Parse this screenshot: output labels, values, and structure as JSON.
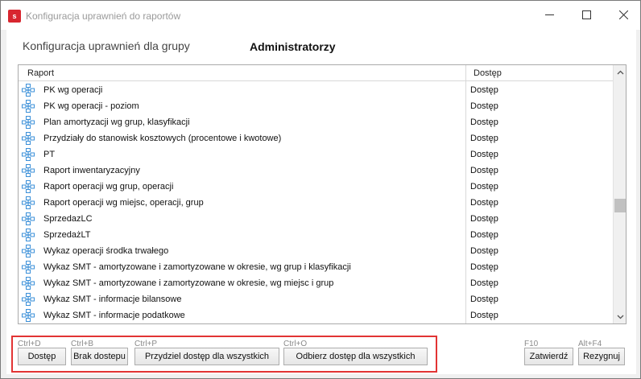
{
  "window": {
    "app_icon_letter": "s",
    "title": "Konfiguracja uprawnień do raportów"
  },
  "header": {
    "group_label": "Konfiguracja uprawnień dla grupy",
    "group_name": "Administratorzy"
  },
  "grid": {
    "columns": {
      "report": "Raport",
      "access": "Dostęp"
    },
    "rows": [
      {
        "name": "PK wg operacji",
        "access": "Dostęp"
      },
      {
        "name": "PK wg operacji - poziom",
        "access": "Dostęp"
      },
      {
        "name": "Plan amortyzacji wg grup, klasyfikacji",
        "access": "Dostęp"
      },
      {
        "name": "Przydziały do stanowisk kosztowych (procentowe i kwotowe)",
        "access": "Dostęp"
      },
      {
        "name": "PT",
        "access": "Dostęp"
      },
      {
        "name": "Raport inwentaryzacyjny",
        "access": "Dostęp"
      },
      {
        "name": "Raport operacji wg grup, operacji",
        "access": "Dostęp"
      },
      {
        "name": "Raport operacji wg miejsc, operacji, grup",
        "access": "Dostęp"
      },
      {
        "name": "SprzedazLC",
        "access": "Dostęp"
      },
      {
        "name": "SprzedażLT",
        "access": "Dostęp"
      },
      {
        "name": "Wykaz operacji środka trwałego",
        "access": "Dostęp"
      },
      {
        "name": "Wykaz SMT - amortyzowane i zamortyzowane w okresie, wg grup i klasyfikacji",
        "access": "Dostęp"
      },
      {
        "name": "Wykaz SMT - amortyzowane i zamortyzowane w okresie, wg miejsc i grup",
        "access": "Dostęp"
      },
      {
        "name": "Wykaz SMT - informacje bilansowe",
        "access": "Dostęp"
      },
      {
        "name": "Wykaz SMT - informacje podatkowe",
        "access": "Dostęp"
      }
    ],
    "row_icon": "report-node-icon",
    "scroll_position": 0.55
  },
  "actions": {
    "grant": {
      "shortcut": "Ctrl+D",
      "label": "Dostęp"
    },
    "deny": {
      "shortcut": "Ctrl+B",
      "label": "Brak dostepu"
    },
    "grant_all": {
      "shortcut": "Ctrl+P",
      "label": "Przydziel dostęp dla wszystkich"
    },
    "revoke_all": {
      "shortcut": "Ctrl+O",
      "label": "Odbierz dostęp dla wszystkich"
    }
  },
  "dialog": {
    "confirm": {
      "shortcut": "F10",
      "label": "Zatwierdź"
    },
    "cancel": {
      "shortcut": "Alt+F4",
      "label": "Rezygnuj"
    }
  },
  "colors": {
    "highlight_frame": "#e23434",
    "app_icon": "#d8262f",
    "row_icon": "#3a8fd8"
  }
}
